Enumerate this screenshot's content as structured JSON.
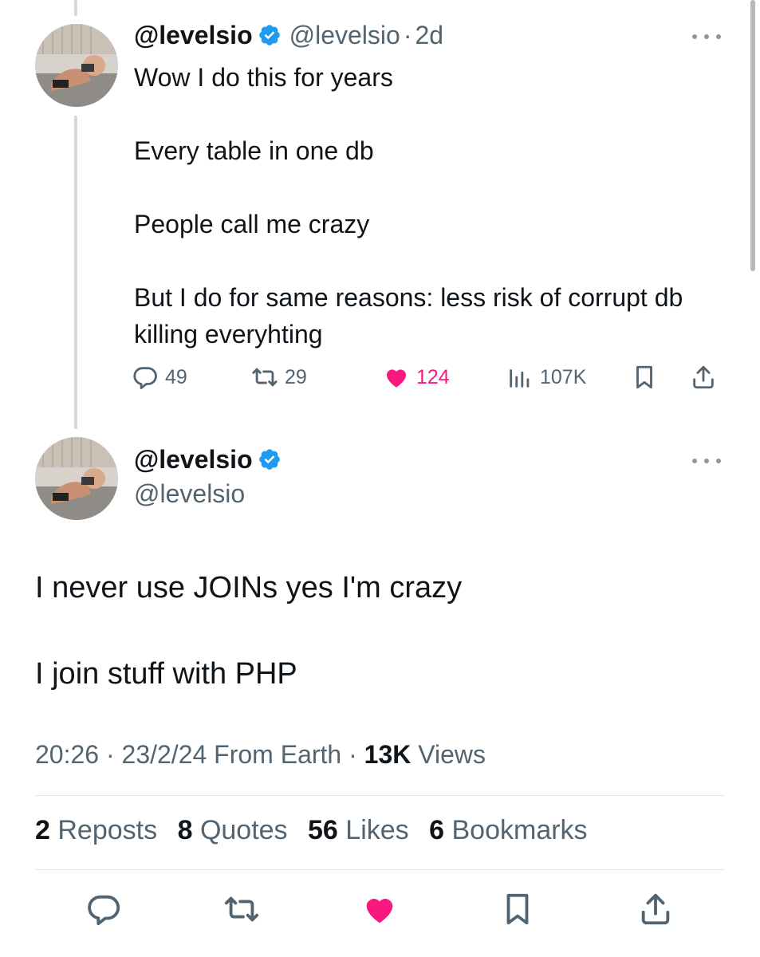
{
  "parent_tweet": {
    "display_name": "@levelsio",
    "handle": "@levelsio",
    "separator": "·",
    "age": "2d",
    "lines": [
      "Wow I do this for years",
      "Every table in one db",
      "People call me crazy",
      "But I do for same reasons: less risk of corrupt db killing everyhting"
    ],
    "actions": {
      "replies": "49",
      "reposts": "29",
      "likes": "124",
      "views": "107K"
    }
  },
  "main_tweet": {
    "display_name": "@levelsio",
    "handle": "@levelsio",
    "lines": [
      "I never use JOINs yes I'm crazy",
      "I join stuff with PHP"
    ],
    "meta": {
      "time": "20:26",
      "date": "23/2/24",
      "source": "From Earth",
      "views_count": "13K",
      "views_label": "Views",
      "separator": "·"
    },
    "stats": {
      "reposts_count": "2",
      "reposts_label": "Reposts",
      "quotes_count": "8",
      "quotes_label": "Quotes",
      "likes_count": "56",
      "likes_label": "Likes",
      "bookmarks_count": "6",
      "bookmarks_label": "Bookmarks"
    }
  },
  "colors": {
    "text": "#0f1419",
    "secondary": "#536471",
    "like": "#f91880",
    "verified": "#1d9bf0",
    "icon": "#536471"
  },
  "icons": {
    "verified": "verified-badge-icon",
    "more": "more-dots-icon",
    "reply": "reply-icon",
    "repost": "repost-icon",
    "like": "heart-icon",
    "views": "views-chart-icon",
    "bookmark": "bookmark-icon",
    "share": "share-icon"
  }
}
